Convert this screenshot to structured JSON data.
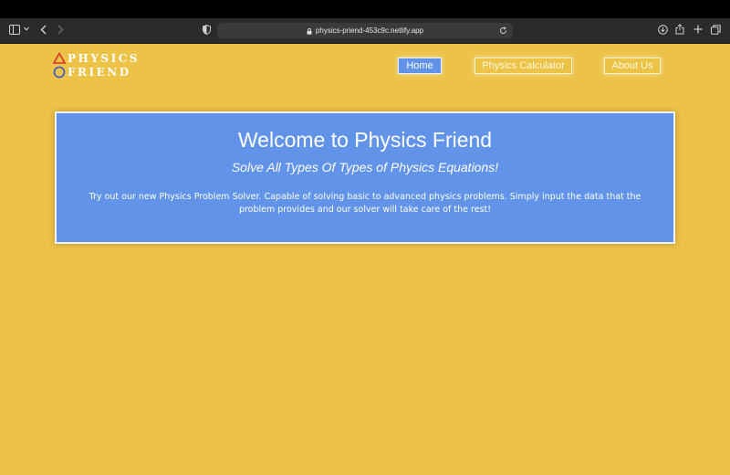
{
  "browser": {
    "url": "physics-priend-453c9c.netlify.app"
  },
  "logo": {
    "line1": "PHYSICS",
    "line2": "FRIEND"
  },
  "nav": {
    "items": [
      {
        "label": "Home",
        "active": true
      },
      {
        "label": "Physics Calculator",
        "active": false
      },
      {
        "label": "About Us",
        "active": false
      }
    ]
  },
  "hero": {
    "title": "Welcome to Physics Friend",
    "subtitle": "Solve All Types Of Types of Physics Equations!",
    "body": "Try out our new Physics Problem Solver. Capable of solving basic to advanced physics problems. Simply input the data that the problem provides and our solver will take care of the rest!"
  },
  "colors": {
    "page_bg": "#ecc247",
    "accent_blue": "#6194e8",
    "logo_triangle": "#d8332a",
    "logo_circle": "#3a54c8"
  },
  "icons": [
    "sidebar-icon",
    "chevron-down-icon",
    "back-icon",
    "forward-icon",
    "shield-icon",
    "lock-icon",
    "reload-icon",
    "download-icon",
    "share-icon",
    "new-tab-icon",
    "tabs-overview-icon"
  ]
}
